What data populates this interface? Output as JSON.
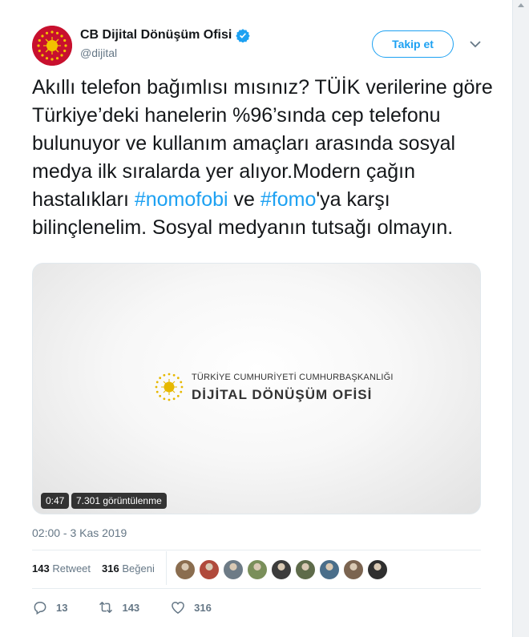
{
  "user": {
    "name": "CB Dijital Dönüşüm Ofisi",
    "handle": "@dijital",
    "follow_label": "Takip et"
  },
  "tweet": {
    "text_parts": [
      "Akıllı telefon bağımlısı mısınız? TÜİK verilerine göre Türkiye’deki hanelerin %96’sında cep telefonu bulunuyor ve kullanım amaçları arasında sosyal medya ilk sıralarda yer alıyor.Modern çağın hastalıkları ",
      "#nomofobi",
      " ve ",
      "#fomo",
      "'ya karşı bilinçlenelim. Sosyal medyanın tutsağı olmayın."
    ],
    "timestamp": "02:00 - 3 Kas 2019"
  },
  "media": {
    "logo_line1": "TÜRKİYE CUMHURİYETİ CUMHURBAŞKANLIĞI",
    "logo_line2": "DİJİTAL DÖNÜŞÜM OFİSİ",
    "duration": "0:47",
    "views": "7.301 görüntülenme"
  },
  "stats": {
    "retweets_count": "143",
    "retweets_label": "Retweet",
    "likes_count": "316",
    "likes_label": "Beğeni"
  },
  "likers": [
    "#8a6d4f",
    "#b04a3c",
    "#6d7b86",
    "#7a8f5a",
    "#3c3c3c",
    "#5e6b4a",
    "#4a6e8a",
    "#7b6450",
    "#2f2f2f"
  ],
  "actions": {
    "reply_count": "13",
    "retweet_count": "143",
    "like_count": "316"
  },
  "colors": {
    "accent": "#1da1f2",
    "emblem_red": "#c8102e",
    "emblem_gold": "#e6b800"
  }
}
